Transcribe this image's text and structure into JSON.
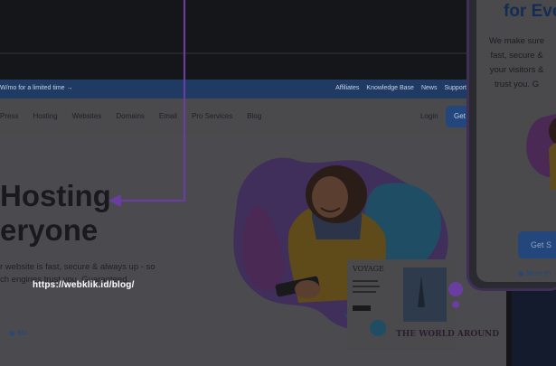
{
  "promo_bar": {
    "left_text": "W/mo for a limited time →",
    "links": [
      "Affiliates",
      "Knowledge Base",
      "News",
      "Support"
    ]
  },
  "nav": {
    "items": [
      "Press",
      "Hosting",
      "Websites",
      "Domains",
      "Email",
      "Pro Services",
      "Blog"
    ],
    "login": "Login",
    "cta": "Get"
  },
  "hero": {
    "title_line1": "Hosting",
    "title_line2": "eryone",
    "subtitle_line1": "r website is fast, secure & always up - so",
    "subtitle_line2": "ch engines trust you. Guaranteed.",
    "more_link": "Mo"
  },
  "overlay_url": "https://webklik.id/blog/",
  "mockup_card": {
    "title": "VOYAGE",
    "headline": "THE WORLD AROUND"
  },
  "phone": {
    "title": "for Eve",
    "text": "We make sure\nfast, secure &\nyour visitors &\ntrust you. G",
    "button": "Get S",
    "more": "More th"
  },
  "colors": {
    "accent_purple": "#6a3ea1",
    "brand_blue": "#23467c"
  }
}
